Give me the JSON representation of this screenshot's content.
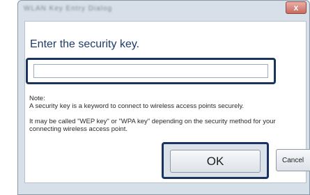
{
  "window": {
    "title": "WLAN Key Entry Dialog",
    "close_label": "x"
  },
  "dialog": {
    "heading": "Enter the security key.",
    "key_input": {
      "value": "",
      "placeholder": ""
    },
    "note": {
      "label": "Note:",
      "line1": "A security key is a keyword to connect to wireless access points securely.",
      "line2": "It may be called \"WEP key\" or \"WPA key\" depending on the security method for your",
      "line3": "connecting wireless access point."
    }
  },
  "buttons": {
    "ok_label": "OK",
    "cancel_label": "Cancel"
  },
  "colors": {
    "highlight_border": "#18345f",
    "heading_text": "#1f3a68",
    "frame": "#d7dfe8"
  }
}
